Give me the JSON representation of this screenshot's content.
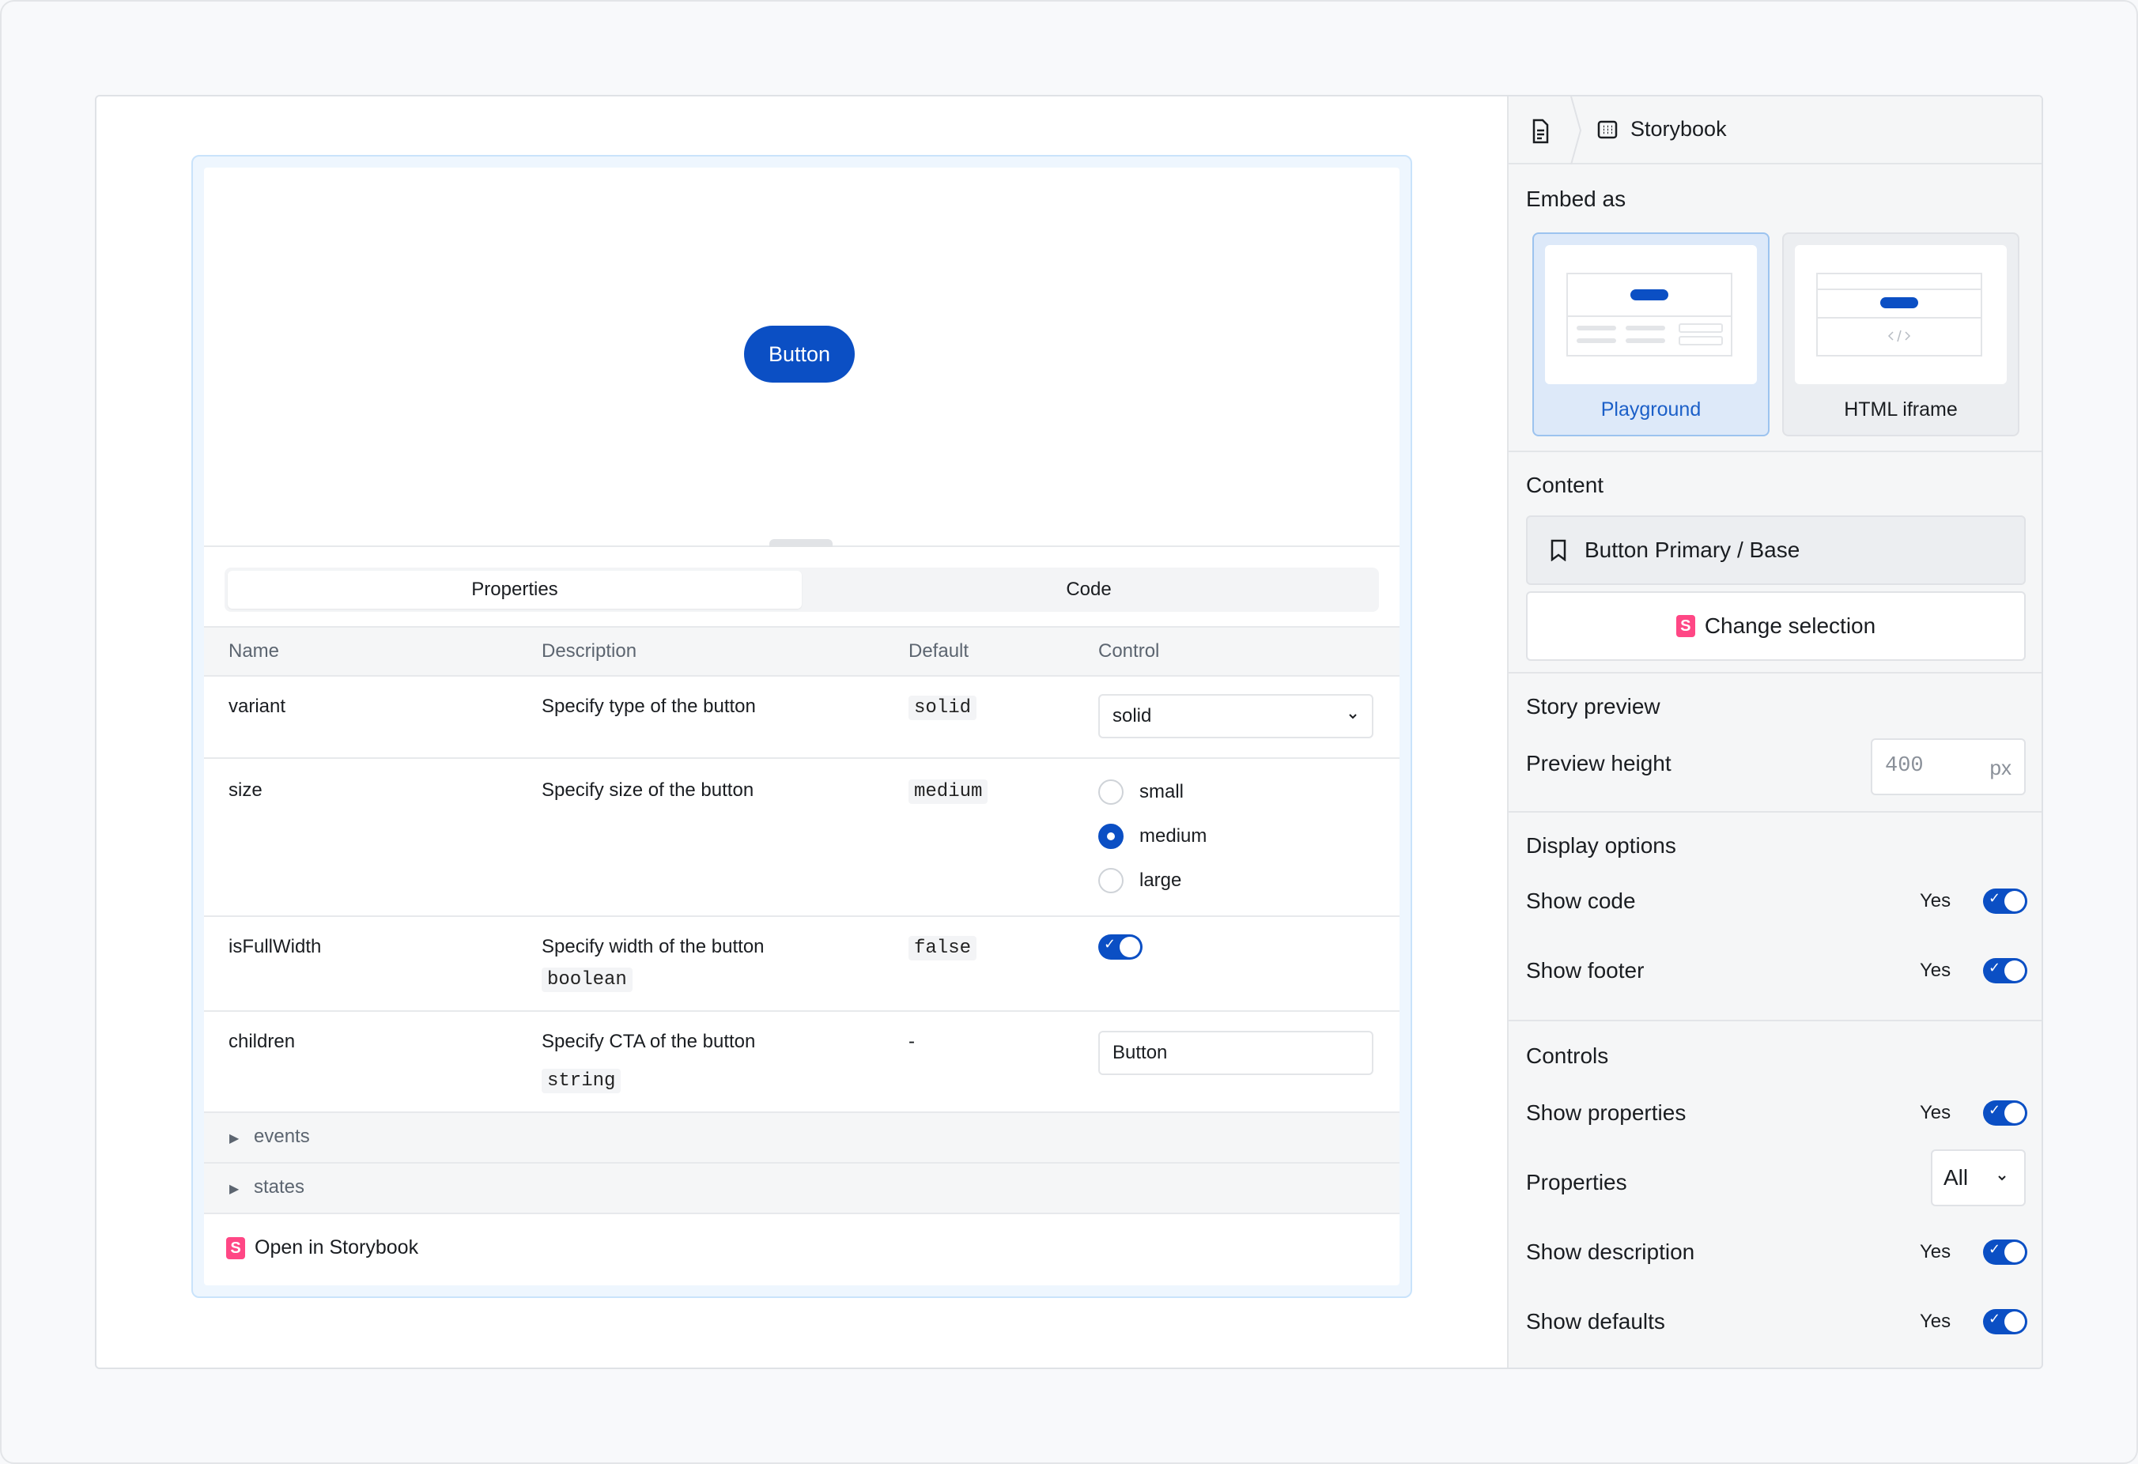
{
  "preview": {
    "button_label": "Button"
  },
  "tabs": [
    {
      "label": "Properties",
      "active": true
    },
    {
      "label": "Code",
      "active": false
    }
  ],
  "props_table": {
    "headers": {
      "name": "Name",
      "description": "Description",
      "default": "Default",
      "control": "Control"
    },
    "rows": [
      {
        "name": "variant",
        "description": "Specify type of the button",
        "type": "",
        "default": "solid",
        "control_value": "solid"
      },
      {
        "name": "size",
        "description": "Specify size of the button",
        "type": "",
        "default": "medium",
        "options": [
          "small",
          "medium",
          "large"
        ],
        "selected": "medium"
      },
      {
        "name": "isFullWidth",
        "description": "Specify width of the button",
        "type": "boolean",
        "default": "false",
        "toggle_on": true
      },
      {
        "name": "children",
        "description": "Specify CTA of the button",
        "type": "string",
        "default": "-",
        "control_value": "Button"
      }
    ],
    "groups": [
      "events",
      "states"
    ],
    "footer_link": "Open in Storybook"
  },
  "panel": {
    "breadcrumb": {
      "title": "Storybook"
    },
    "embed_as": {
      "title": "Embed as",
      "options": [
        {
          "label": "Playground",
          "selected": true
        },
        {
          "label": "HTML iframe",
          "selected": false
        }
      ]
    },
    "content": {
      "title": "Content",
      "story": "Button Primary / Base",
      "change_label": "Change selection"
    },
    "story_preview": {
      "title": "Story preview",
      "height_label": "Preview height",
      "height_placeholder": "400",
      "unit": "px"
    },
    "display_options": {
      "title": "Display options",
      "items": [
        {
          "label": "Show code",
          "value": "Yes",
          "on": true
        },
        {
          "label": "Show footer",
          "value": "Yes",
          "on": true
        }
      ]
    },
    "controls": {
      "title": "Controls",
      "show_properties": {
        "label": "Show properties",
        "value": "Yes",
        "on": true
      },
      "properties": {
        "label": "Properties",
        "value": "All"
      },
      "show_description": {
        "label": "Show description",
        "value": "Yes",
        "on": true
      },
      "show_defaults": {
        "label": "Show defaults",
        "value": "Yes",
        "on": true
      }
    }
  },
  "colors": {
    "accent": "#0b4fc4",
    "storybook_pink": "#ff4785"
  }
}
